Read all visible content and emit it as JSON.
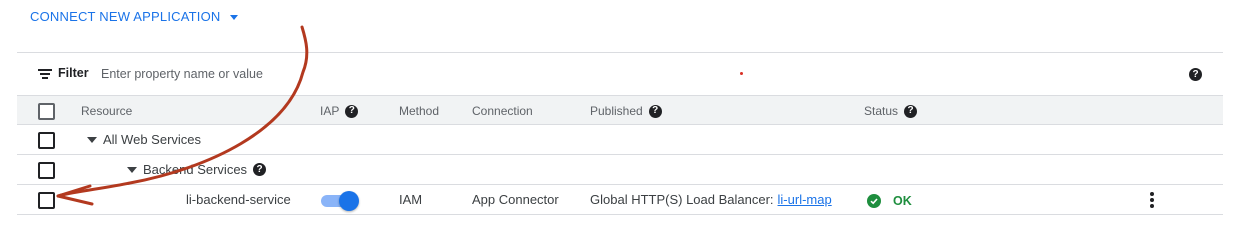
{
  "toolbar": {
    "connect_label": "CONNECT NEW APPLICATION"
  },
  "filter": {
    "label": "Filter",
    "placeholder": "Enter property name or value"
  },
  "table": {
    "columns": {
      "resource": "Resource",
      "iap": "IAP",
      "method": "Method",
      "connection": "Connection",
      "published": "Published",
      "status": "Status"
    },
    "rows": {
      "all_web_services": {
        "resource": "All Web Services"
      },
      "backend_services": {
        "resource": "Backend Services"
      },
      "service": {
        "resource": "li-backend-service",
        "iap_enabled": true,
        "method": "IAM",
        "connection": "App Connector",
        "published_prefix": "Global HTTP(S) Load Balancer:",
        "published_link": "li-url-map",
        "status": "OK"
      }
    }
  },
  "colors": {
    "accent": "#1a73e8",
    "ok": "#1e8e3e",
    "annotation": "#b3391f"
  },
  "icons": [
    "chevron-down-icon",
    "filter-icon",
    "help-icon",
    "expand-icon",
    "check-circle-icon",
    "more-vert-icon",
    "annotation-arrow"
  ]
}
